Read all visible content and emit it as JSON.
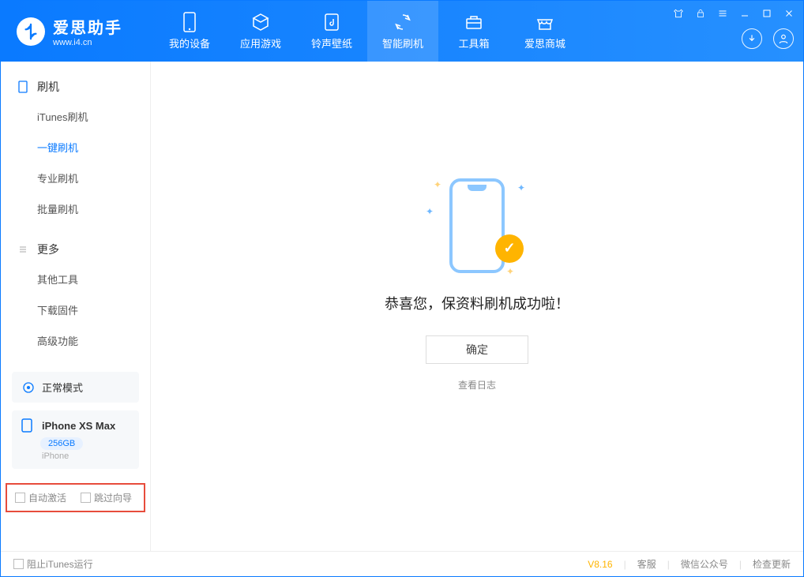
{
  "app": {
    "title": "爱思助手",
    "subtitle": "www.i4.cn"
  },
  "nav": {
    "tabs": [
      {
        "label": "我的设备"
      },
      {
        "label": "应用游戏"
      },
      {
        "label": "铃声壁纸"
      },
      {
        "label": "智能刷机"
      },
      {
        "label": "工具箱"
      },
      {
        "label": "爱思商城"
      }
    ]
  },
  "sidebar": {
    "section_flash": {
      "title": "刷机",
      "items": [
        {
          "label": "iTunes刷机"
        },
        {
          "label": "一键刷机"
        },
        {
          "label": "专业刷机"
        },
        {
          "label": "批量刷机"
        }
      ]
    },
    "section_more": {
      "title": "更多",
      "items": [
        {
          "label": "其他工具"
        },
        {
          "label": "下载固件"
        },
        {
          "label": "高级功能"
        }
      ]
    },
    "status": {
      "label": "正常模式"
    },
    "device": {
      "name": "iPhone XS Max",
      "capacity": "256GB",
      "type": "iPhone"
    },
    "checks": {
      "auto_activate": "自动激活",
      "skip_guide": "跳过向导"
    }
  },
  "main": {
    "success_text": "恭喜您，保资料刷机成功啦！",
    "ok_btn": "确定",
    "view_log": "查看日志"
  },
  "footer": {
    "block_itunes": "阻止iTunes运行",
    "version": "V8.16",
    "links": {
      "support": "客服",
      "wechat": "微信公众号",
      "update": "检查更新"
    }
  }
}
